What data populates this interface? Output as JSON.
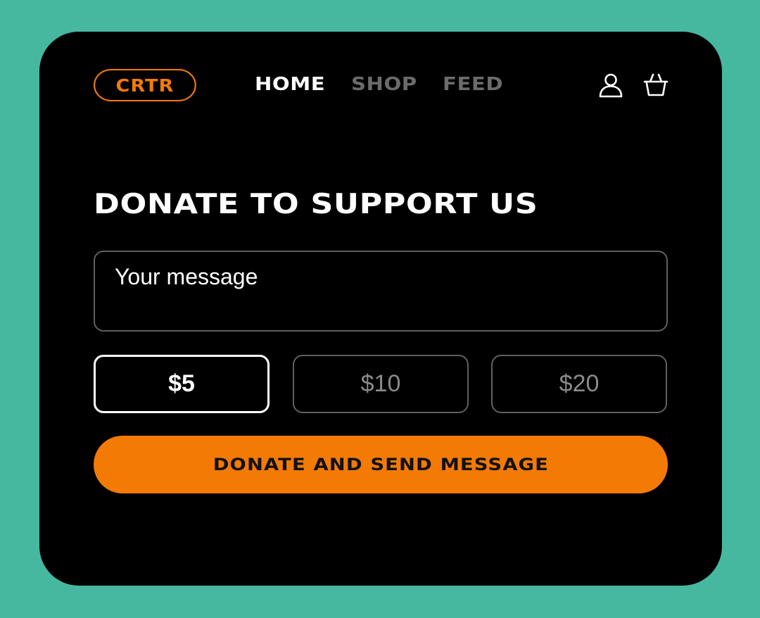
{
  "header": {
    "logo_text": "CRTR",
    "nav": [
      {
        "label": "HOME",
        "active": true
      },
      {
        "label": "SHOP",
        "active": false
      },
      {
        "label": "FEED",
        "active": false
      }
    ],
    "icons": [
      "user-icon",
      "basket-icon"
    ]
  },
  "main": {
    "title": "DONATE TO SUPPORT US",
    "message": {
      "placeholder": "Your message",
      "value": ""
    },
    "amounts": [
      {
        "label": "$5",
        "selected": true
      },
      {
        "label": "$10",
        "selected": false
      },
      {
        "label": "$20",
        "selected": false
      }
    ],
    "submit_label": "DONATE AND SEND MESSAGE"
  },
  "colors": {
    "background": "#46b8a0",
    "card": "#000000",
    "accent": "#f37a04",
    "text_primary": "#ffffff",
    "text_muted": "#6b6b6b",
    "border_muted": "#5f5f5f"
  }
}
